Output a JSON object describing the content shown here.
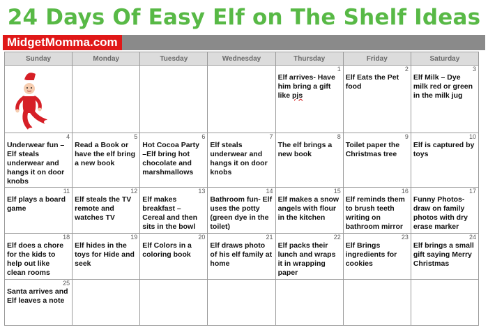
{
  "title": "24 Days Of Easy Elf on The Shelf Ideas",
  "brand": "MidgetMomma.com",
  "weekdays": [
    "Sunday",
    "Monday",
    "Tuesday",
    "Wednesday",
    "Thursday",
    "Friday",
    "Saturday"
  ],
  "weeks": [
    [
      {
        "day": "",
        "idea": ""
      },
      {
        "day": "",
        "idea": ""
      },
      {
        "day": "",
        "idea": ""
      },
      {
        "day": "",
        "idea": ""
      },
      {
        "day": "1",
        "idea": "Elf arrives- Have him bring a gift like ",
        "idea_tail": "pjs"
      },
      {
        "day": "2",
        "idea": "Elf Eats the Pet food"
      },
      {
        "day": "3",
        "idea": "Elf Milk – Dye milk red or green in the milk jug"
      }
    ],
    [
      {
        "day": "4",
        "idea": "Underwear fun – Elf steals underwear and hangs it on door knobs"
      },
      {
        "day": "5",
        "idea": "Read a Book or have the elf bring a new book"
      },
      {
        "day": "6",
        "idea": "Hot Cocoa Party –Elf bring hot chocolate and marshmallows"
      },
      {
        "day": "7",
        "idea": "Elf steals underwear and hangs it on door knobs"
      },
      {
        "day": "8",
        "idea": "The elf brings a new book"
      },
      {
        "day": "9",
        "idea": "Toilet paper the Christmas tree"
      },
      {
        "day": "10",
        "idea": "Elf is captured by toys"
      }
    ],
    [
      {
        "day": "11",
        "idea": "Elf plays a board game"
      },
      {
        "day": "12",
        "idea": "Elf steals the TV remote and watches TV"
      },
      {
        "day": "13",
        "idea": "Elf makes breakfast – Cereal and then sits in the bowl"
      },
      {
        "day": "14",
        "idea": "Bathroom fun- Elf uses the potty (green dye in the toilet)"
      },
      {
        "day": "15",
        "idea": "Elf makes a snow angels with flour in the kitchen"
      },
      {
        "day": "16",
        "idea": "Elf reminds them to brush teeth writing on bathroom mirror"
      },
      {
        "day": "17",
        "idea": "Funny Photos- draw on family photos with dry erase marker"
      }
    ],
    [
      {
        "day": "18",
        "idea": "Elf does a chore for the kids to help out like clean rooms"
      },
      {
        "day": "19",
        "idea": "Elf hides in the toys for Hide and seek"
      },
      {
        "day": "20",
        "idea": "Elf Colors in a coloring book"
      },
      {
        "day": "21",
        "idea": "Elf draws photo of his elf family at home"
      },
      {
        "day": "22",
        "idea": "Elf packs their lunch and wraps it in wrapping paper"
      },
      {
        "day": "23",
        "idea": "Elf Brings ingredients for cookies"
      },
      {
        "day": "24",
        "idea": "Elf brings a small gift saying Merry Christmas"
      }
    ],
    [
      {
        "day": "25",
        "idea": "Santa arrives and Elf leaves a note"
      },
      {
        "day": "",
        "idea": ""
      },
      {
        "day": "",
        "idea": ""
      },
      {
        "day": "",
        "idea": ""
      },
      {
        "day": "",
        "idea": ""
      },
      {
        "day": "",
        "idea": ""
      },
      {
        "day": "",
        "idea": ""
      }
    ]
  ],
  "colors": {
    "title": "#58b946",
    "brand_bg": "#e01818",
    "bar": "#8a8a8a",
    "header_bg": "#dcdcdc"
  },
  "icons": {
    "elf": "elf-on-shelf-icon"
  }
}
